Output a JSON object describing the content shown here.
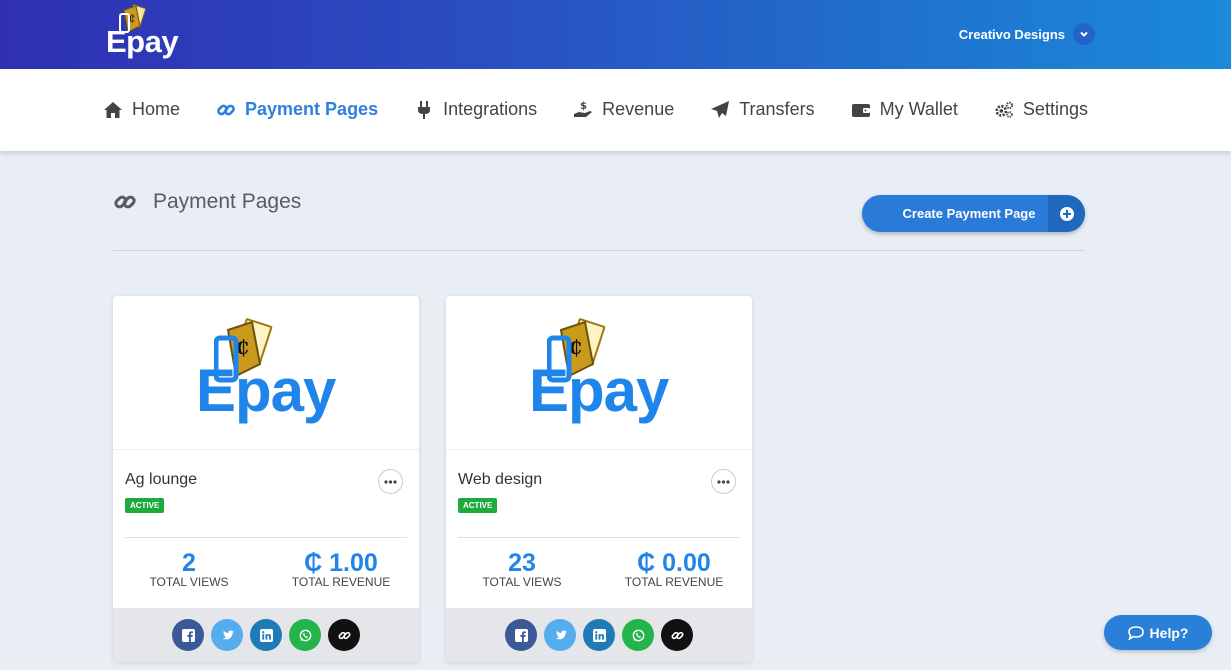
{
  "brand": {
    "logo_text": "Epay",
    "header_gradient_start": "#2f2fb4",
    "header_gradient_end": "#1a8ad9",
    "accent": "#2e7fe0"
  },
  "account": {
    "name": "Creativo Designs",
    "icon": "chevron-down-icon"
  },
  "nav": {
    "items": [
      {
        "label": "Home",
        "icon": "home-icon",
        "active": false
      },
      {
        "label": "Payment Pages",
        "icon": "link-icon",
        "active": true
      },
      {
        "label": "Integrations",
        "icon": "plug-icon",
        "active": false
      },
      {
        "label": "Revenue",
        "icon": "hand-money-icon",
        "active": false
      },
      {
        "label": "Transfers",
        "icon": "paper-plane-icon",
        "active": false
      },
      {
        "label": "My Wallet",
        "icon": "wallet-icon",
        "active": false
      },
      {
        "label": "Settings",
        "icon": "gears-icon",
        "active": false
      }
    ]
  },
  "page": {
    "title": "Payment Pages",
    "create_button": "Create Payment Page"
  },
  "cards": [
    {
      "name": "Ag lounge",
      "status": "ACTIVE",
      "views_value": "2",
      "views_label": "TOTAL VIEWS",
      "revenue_value": "₵ 1.00",
      "revenue_label": "TOTAL REVENUE",
      "logo_text": "Epay"
    },
    {
      "name": "Web design",
      "status": "ACTIVE",
      "views_value": "23",
      "views_label": "TOTAL VIEWS",
      "revenue_value": "₵ 0.00",
      "revenue_label": "TOTAL REVENUE",
      "logo_text": "Epay"
    }
  ],
  "share_buttons": [
    {
      "icon": "facebook-icon",
      "color": "#3b5998"
    },
    {
      "icon": "twitter-icon",
      "color": "#55acee"
    },
    {
      "icon": "linkedin-icon",
      "color": "#1e7bb8"
    },
    {
      "icon": "whatsapp-icon",
      "color": "#25b34b"
    },
    {
      "icon": "copy-link-icon",
      "color": "#111111"
    }
  ],
  "help": {
    "label": "Help?"
  }
}
